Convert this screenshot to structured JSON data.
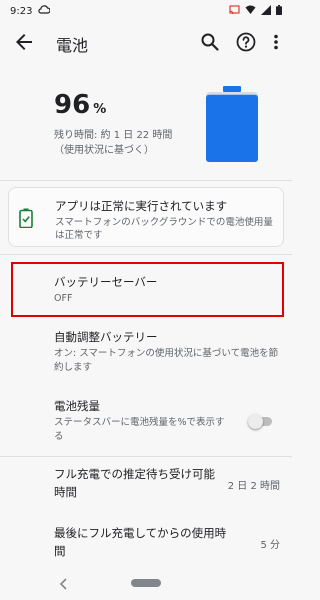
{
  "status_bar": {
    "time": "9:23"
  },
  "app_bar": {
    "title": "電池"
  },
  "battery": {
    "percent": "96",
    "percent_sign": "%",
    "remaining_line1": "残り時間: 約 1 日 22 時間",
    "remaining_line2": "（使用状況に基づく）",
    "level": 0.96,
    "color": "#1a73e8"
  },
  "status_card": {
    "title": "アプリは正常に実行されています",
    "text": "スマートフォンのバックグラウンドでの電池使用量は正常です",
    "icon_color": "#188038"
  },
  "settings": {
    "battery_saver": {
      "title": "バッテリーセーバー",
      "sub": "OFF"
    },
    "adaptive": {
      "title": "自動調整バッテリー",
      "sub": "オン: スマートフォンの使用状況に基づいて電池を節約します"
    },
    "percentage": {
      "title": "電池残量",
      "sub": "ステータスバーに電池残量を%で表示する",
      "enabled": false
    },
    "full_charge_standby": {
      "title_line1": "フル充電での推定待ち受け可能",
      "title_line2": "時間",
      "value": "2 日 2 時間"
    },
    "since_full_charge": {
      "title_line1": "最後にフル充電してからの使用時",
      "title_line2": "間",
      "value": "5 分"
    }
  },
  "colors": {
    "highlight_border": "#e00000",
    "accent": "#1a73e8"
  }
}
